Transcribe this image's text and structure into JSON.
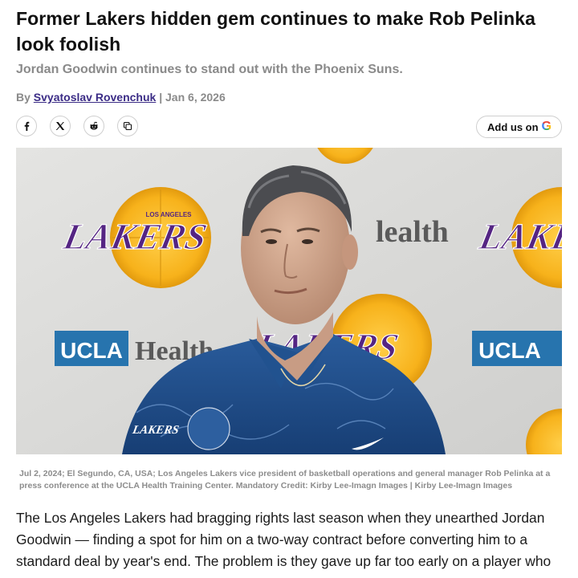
{
  "article": {
    "title": "Former Lakers hidden gem continues to make Rob Pelinka look foolish",
    "subtitle": "Jordan Goodwin continues to stand out with the Phoenix Suns.",
    "byline_prefix": "By",
    "author": "Svyatoslav Rovenchuk",
    "separator": "|",
    "date": "Jan 6, 2026",
    "image_caption": "Jul 2, 2024; El Segundo, CA, USA; Los Angeles Lakers vice president of basketball operations and general manager Rob Pelinka at a press conference at the UCLA Health Training Center. Mandatory Credit: Kirby Lee-Imagn Images | Kirby Lee-Imagn Images",
    "body": "The Los Angeles Lakers had bragging rights last season when they unearthed Jordan Goodwin — finding a spot for him on a two-way contract before converting him to a standard deal by year's end. The problem is they gave up far too early on a player who"
  },
  "share": {
    "icons": [
      "facebook-icon",
      "x-icon",
      "reddit-icon",
      "copy-link-icon"
    ],
    "add_us_label": "Add us on",
    "google_glyph": "G"
  },
  "photo": {
    "backdrop_texts": {
      "lakers": "LAKERS",
      "los_angeles": "LOS ANGELES",
      "ucla": "UCLA",
      "health": "Health",
      "health_partial": "lealth"
    },
    "colors": {
      "lakers_gold": "#fdb927",
      "lakers_purple": "#552583",
      "ucla_blue": "#2774ae",
      "shirt_blue": "#1f4f8f"
    }
  }
}
